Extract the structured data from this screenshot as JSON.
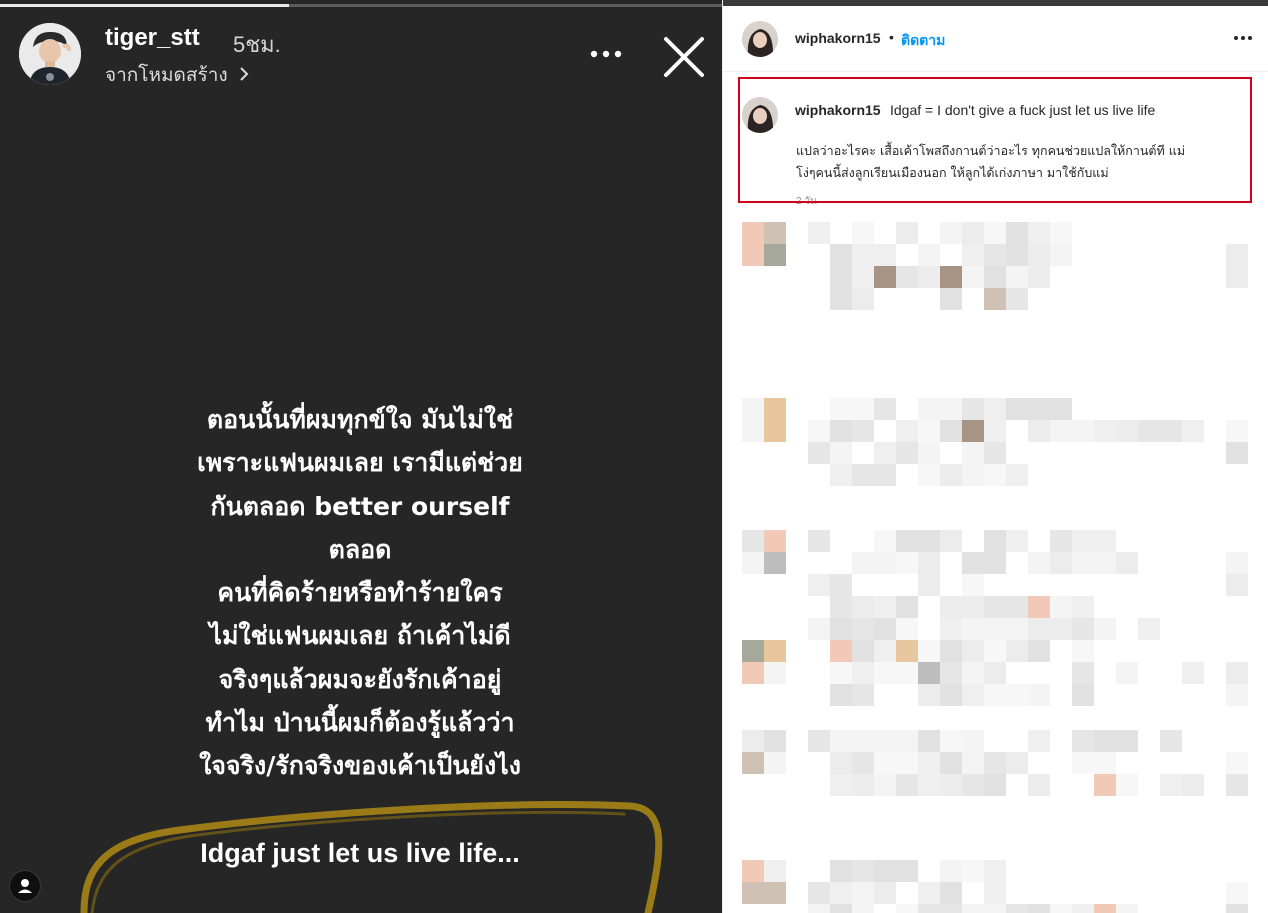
{
  "story": {
    "username": "tiger_stt",
    "time": "5ชม.",
    "subtitle": "จากโหมดสร้าง",
    "text_lines": [
      "ตอนนั้นที่ผมทุกข์ใจ มันไม่ใช่",
      "เพราะแฟนผมเลย เรามีแต่ช่วย",
      "กันตลอด better ourself",
      "ตลอด",
      "คนที่คิดร้ายหรือทำร้ายใคร",
      "ไม่ใช่แฟนผมเลย ถ้าเค้าไม่ดี",
      "จริงๆแล้วผมจะยังรักเค้าอยู่",
      "ทำไม ป่านนี้ผมก็ต้องรู้แล้วว่า",
      "ใจจริง/รักจริงของเค้าเป็นยังไง"
    ],
    "highlight_text": "Idgaf just let us live life...",
    "progress": 0.4,
    "icons": {
      "more": "more-horizontal-icon",
      "close": "close-icon",
      "person": "person-icon"
    }
  },
  "post": {
    "header": {
      "username": "wiphakorn15",
      "separator": "•",
      "follow_label": "ติดตาม"
    },
    "caption": {
      "username": "wiphakorn15",
      "text_line1": "Idgaf = I don't give a fuck just let us live life",
      "text_lines": [
        "แปลว่าอะไรคะ เสื้อเค้าโพสถึงกานต์ว่าอะไร ทุกคนช่วยแปลให้กานต์ที แม่",
        "โง่ๆคนนี้ส่งลูกเรียนเมืองนอก ให้ลูกได้เก่งภาษา มาใช้กับแม่"
      ],
      "time": "2 วัน"
    },
    "highlight_box_color": "#d0021b",
    "follow_color": "#0095f6"
  }
}
